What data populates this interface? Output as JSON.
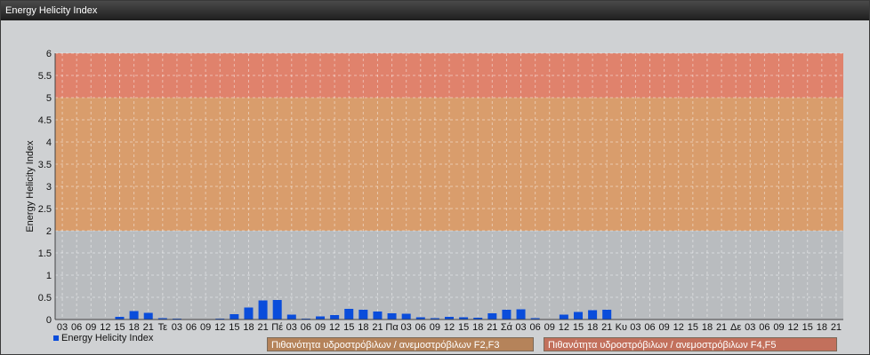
{
  "window": {
    "title": "Energy Helicity Index"
  },
  "legend": {
    "series_label": "Energy Helicity Index",
    "band_f2f3": "Πιθανότητα υδροστρόβιλων / ανεμοστρόβιλων F2,F3",
    "band_f4f5": "Πιθανότητα υδροστρόβιλων / ανεμοστρόβιλων F4,F5"
  },
  "colors": {
    "bar": "#0a4ddb",
    "band_low": "#b9bcbf",
    "band_mid": "#d99d6c",
    "band_high": "#e0826c",
    "legend_mid": "#b5835a",
    "legend_high": "#c2705c"
  },
  "chart_data": {
    "type": "bar",
    "ylabel": "Energy Helicity Index",
    "ylim": [
      0,
      6
    ],
    "yticks": [
      "0",
      "0.5",
      "1",
      "1.5",
      "2",
      "2.5",
      "3",
      "3.5",
      "4",
      "4.5",
      "5",
      "5.5",
      "6"
    ],
    "bands": [
      {
        "from": 0,
        "to": 2,
        "level": "low"
      },
      {
        "from": 2,
        "to": 5,
        "level": "F2,F3"
      },
      {
        "from": 5,
        "to": 6,
        "level": "F4,F5"
      }
    ],
    "categories": [
      "03",
      "06",
      "09",
      "12",
      "15",
      "18",
      "21",
      "Τε",
      "03",
      "06",
      "09",
      "12",
      "15",
      "18",
      "21",
      "Πέ",
      "03",
      "06",
      "09",
      "12",
      "15",
      "18",
      "21",
      "Πα",
      "03",
      "06",
      "09",
      "12",
      "15",
      "18",
      "21",
      "Σά",
      "03",
      "06",
      "09",
      "12",
      "15",
      "18",
      "21",
      "Κυ",
      "03",
      "06",
      "09",
      "12",
      "15",
      "18",
      "21",
      "Δε",
      "03",
      "06",
      "09",
      "12",
      "15",
      "18",
      "21"
    ],
    "series": [
      {
        "name": "Energy Helicity Index",
        "values": [
          0.01,
          0.01,
          0.01,
          0.01,
          0.06,
          0.19,
          0.15,
          0.03,
          0.02,
          0.01,
          0.01,
          0.02,
          0.12,
          0.27,
          0.43,
          0.44,
          0.11,
          0.02,
          0.07,
          0.1,
          0.24,
          0.22,
          0.18,
          0.14,
          0.13,
          0.05,
          0.03,
          0.06,
          0.05,
          0.04,
          0.14,
          0.22,
          0.23,
          0.03,
          0.01,
          0.11,
          0.17,
          0.21,
          0.22,
          0.01,
          0.01,
          0.01,
          0.01,
          0.01,
          0.01,
          0.01,
          0.01,
          0.01,
          0.01,
          0.01,
          0.01,
          0.01,
          0.01,
          0.01,
          0.01
        ]
      }
    ]
  }
}
